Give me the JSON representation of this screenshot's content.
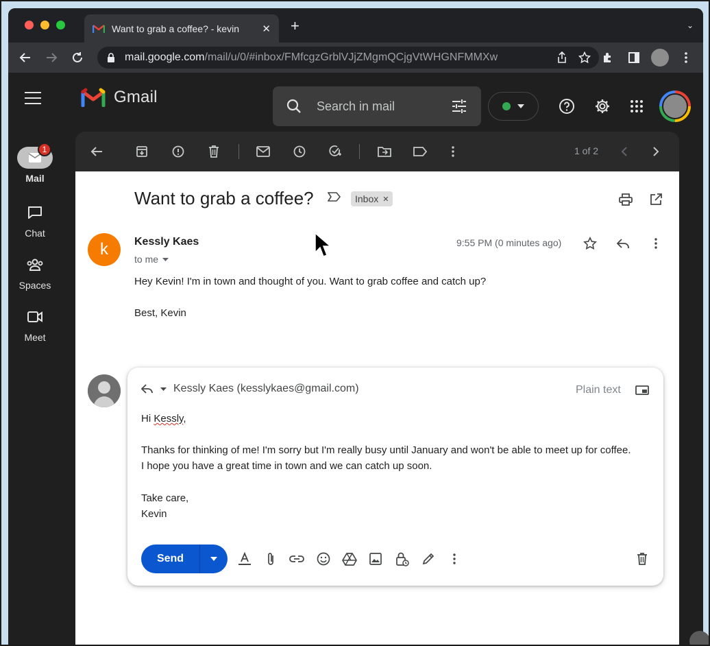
{
  "browser": {
    "tab_title": "Want to grab a coffee? - kevin",
    "url_host": "mail.google.com",
    "url_path": "/mail/u/0/#inbox/FMfcgzGrblVJjZMgmQCjgVtWHGNFMMXw"
  },
  "gmail": {
    "logo_text": "Gmail",
    "search_placeholder": "Search in mail"
  },
  "rail": {
    "mail_label": "Mail",
    "mail_badge": "1",
    "chat_label": "Chat",
    "spaces_label": "Spaces",
    "meet_label": "Meet"
  },
  "toolbar": {
    "pager": "1 of 2"
  },
  "message": {
    "subject": "Want to grab a coffee?",
    "label_chip": "Inbox",
    "sender_initial": "k",
    "sender_name": "Kessly Kaes",
    "to_line": "to me",
    "time": "9:55 PM (0 minutes ago)",
    "body_line1": "Hey Kevin! I'm in town and thought of you. Want to grab coffee and catch up?",
    "body_line2": "Best, Kevin"
  },
  "reply": {
    "recipient": "Kessly Kaes (kesslykaes@gmail.com)",
    "mode": "Plain text",
    "greeting_prefix": "Hi ",
    "greeting_name": "Kessly",
    "greeting_suffix": ",",
    "line1": "Thanks for thinking of me! I'm sorry but I'm really busy until January and won't be able to meet up for coffee.",
    "line2": "I hope you have a great time in town and we can catch up soon.",
    "signoff": "Take care,",
    "signature": "Kevin",
    "send_label": "Send"
  },
  "colors": {
    "send_blue": "#0b57d0",
    "sender_avatar_orange": "#f57c00",
    "badge_red": "#d93025",
    "status_green": "#34a853"
  }
}
